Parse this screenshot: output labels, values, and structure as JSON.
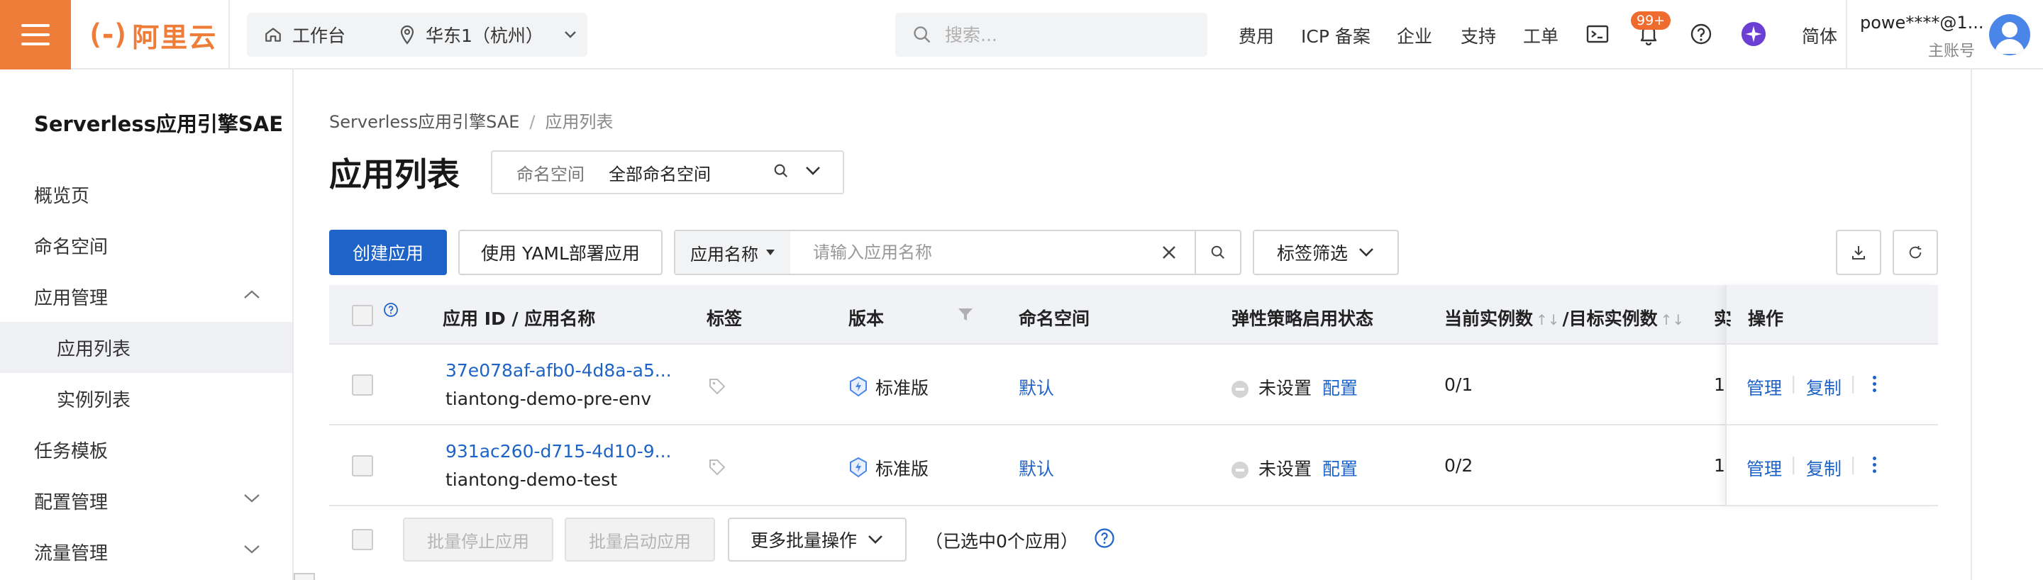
{
  "topbar": {
    "logo_text": "阿里云",
    "workbench": "工作台",
    "region": "华东1（杭州）",
    "search_placeholder": "搜索...",
    "links": {
      "billing": "费用",
      "icp": "ICP 备案",
      "enterprise": "企业",
      "support": "支持",
      "ticket": "工单",
      "language": "简体"
    },
    "notification_badge": "99+",
    "user_name": "powe****@1...",
    "user_role": "主账号",
    "accent_color": "#ef7d3a"
  },
  "sidebar": {
    "title": "Serverless应用引擎SAE",
    "items": [
      {
        "label": "概览页"
      },
      {
        "label": "命名空间"
      },
      {
        "label": "应用管理",
        "expanded": true
      },
      {
        "label": "应用列表",
        "active": true
      },
      {
        "label": "实例列表"
      },
      {
        "label": "任务模板"
      },
      {
        "label": "配置管理",
        "expanded": false
      },
      {
        "label": "流量管理",
        "expanded": false
      }
    ]
  },
  "main": {
    "breadcrumb": {
      "root": "Serverless应用引擎SAE",
      "sep": "/",
      "current": "应用列表"
    },
    "title": "应用列表",
    "namespace": {
      "label": "命名空间",
      "value": "全部命名空间"
    },
    "toolbar": {
      "create": "创建应用",
      "yaml": "使用 YAML部署应用",
      "filter_type": "应用名称",
      "filter_placeholder": "请输入应用名称",
      "tag_filter": "标签筛选"
    },
    "table": {
      "headers": {
        "app": "应用 ID / 应用名称",
        "tags": "标签",
        "version": "版本",
        "namespace": "命名空间",
        "autoscale": "弹性策略启用状态",
        "instances": "当前实例数",
        "target": "/目标实例数",
        "truncated": "实",
        "ops": "操作"
      },
      "rows": [
        {
          "id": "37e078af-afb0-4d8a-a5...",
          "name": "tiantong-demo-pre-env",
          "version": "标准版",
          "namespace": "默认",
          "autoscale": "未设置",
          "config": "配置",
          "instances": "0/1",
          "extra": "1",
          "manage": "管理",
          "copy": "复制"
        },
        {
          "id": "931ac260-d715-4d10-9...",
          "name": "tiantong-demo-test",
          "version": "标准版",
          "namespace": "默认",
          "autoscale": "未设置",
          "config": "配置",
          "instances": "0/2",
          "extra": "1",
          "manage": "管理",
          "copy": "复制"
        }
      ]
    },
    "footer": {
      "stop": "批量停止应用",
      "start": "批量启动应用",
      "more": "更多批量操作",
      "selected": "（已选中0个应用）"
    }
  },
  "colors": {
    "primary": "#1e63c7",
    "brand": "#ef7d3a"
  }
}
